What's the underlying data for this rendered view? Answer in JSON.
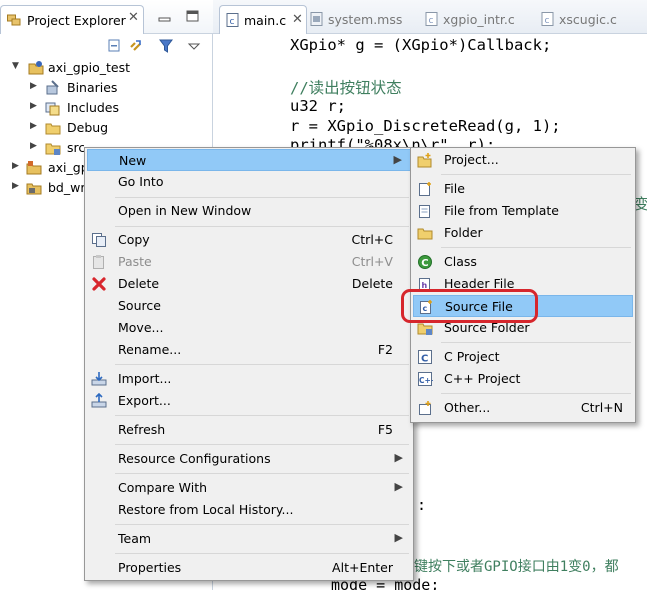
{
  "explorer": {
    "tab_label": "Project Explorer",
    "close_glyph": "✕",
    "tree": [
      {
        "label": "axi_gpio_test",
        "icon": "c-project-icon",
        "expanded": true
      },
      {
        "label": "Binaries",
        "icon": "binaries-icon"
      },
      {
        "label": "Includes",
        "icon": "includes-icon"
      },
      {
        "label": "Debug",
        "icon": "folder-icon"
      },
      {
        "label": "src",
        "icon": "src-folder-icon"
      },
      {
        "label": "axi_gp",
        "icon": "bsp-project-icon"
      },
      {
        "label": "bd_wr",
        "icon": "hw-project-icon"
      }
    ]
  },
  "editor": {
    "tabs": [
      {
        "label": "main.c",
        "icon": "c-file-icon",
        "active": true
      },
      {
        "label": "system.mss",
        "icon": "mss-file-icon"
      },
      {
        "label": "xgpio_intr.c",
        "icon": "c-file-icon"
      },
      {
        "label": "xscugic.c",
        "icon": "c-file-icon"
      }
    ],
    "close_glyph": "✕",
    "code_lines": [
      "XGpio* g = (XGpio*)Callback;",
      "//读出按钮状态",
      "u32 r;",
      "r = XGpio_DiscreteRead(g, 1);",
      "printf(\"%08x\\n\\r\", r);"
    ],
    "fragments": {
      "right_char": "变",
      "colon": ":",
      "bottom_comment": "键按下或者GPIO接口由1变0，都",
      "last_line": "mode = mode;"
    }
  },
  "context_menu": {
    "items": [
      {
        "label": "New",
        "submenu": true,
        "highlight": true
      },
      {
        "label": "Go Into"
      },
      {
        "label": "Open in New Window"
      },
      {
        "label": "Copy",
        "shortcut": "Ctrl+C",
        "icon": "copy-icon"
      },
      {
        "label": "Paste",
        "shortcut": "Ctrl+V",
        "icon": "paste-icon",
        "disabled": true
      },
      {
        "label": "Delete",
        "shortcut": "Delete",
        "icon": "delete-icon"
      },
      {
        "label": "Source"
      },
      {
        "label": "Move..."
      },
      {
        "label": "Rename...",
        "shortcut": "F2"
      },
      {
        "label": "Import...",
        "icon": "import-icon"
      },
      {
        "label": "Export...",
        "icon": "export-icon"
      },
      {
        "label": "Refresh",
        "shortcut": "F5"
      },
      {
        "label": "Resource Configurations",
        "submenu": true
      },
      {
        "label": "Compare With",
        "submenu": true
      },
      {
        "label": "Restore from Local History..."
      },
      {
        "label": "Team",
        "submenu": true
      },
      {
        "label": "Properties",
        "shortcut": "Alt+Enter"
      }
    ]
  },
  "submenu": {
    "items": [
      {
        "label": "Project...",
        "icon": "new-project-icon"
      },
      {
        "label": "File",
        "icon": "new-file-icon"
      },
      {
        "label": "File from Template",
        "icon": "file-template-icon"
      },
      {
        "label": "Folder",
        "icon": "folder-icon"
      },
      {
        "label": "Class",
        "icon": "class-icon"
      },
      {
        "label": "Header File",
        "icon": "header-file-icon"
      },
      {
        "label": "Source File",
        "icon": "source-file-icon",
        "highlight": true
      },
      {
        "label": "Source Folder",
        "icon": "source-folder-icon"
      },
      {
        "label": "C Project",
        "icon": "c-project-icon"
      },
      {
        "label": "C++ Project",
        "icon": "cpp-project-icon"
      },
      {
        "label": "Other...",
        "shortcut": "Ctrl+N",
        "icon": "wizard-icon"
      }
    ]
  },
  "colors": {
    "menu_bg": "#f0f0f0",
    "highlight": "#91c9f7",
    "callout": "#d6262c",
    "comment": "#3f7f5f"
  }
}
